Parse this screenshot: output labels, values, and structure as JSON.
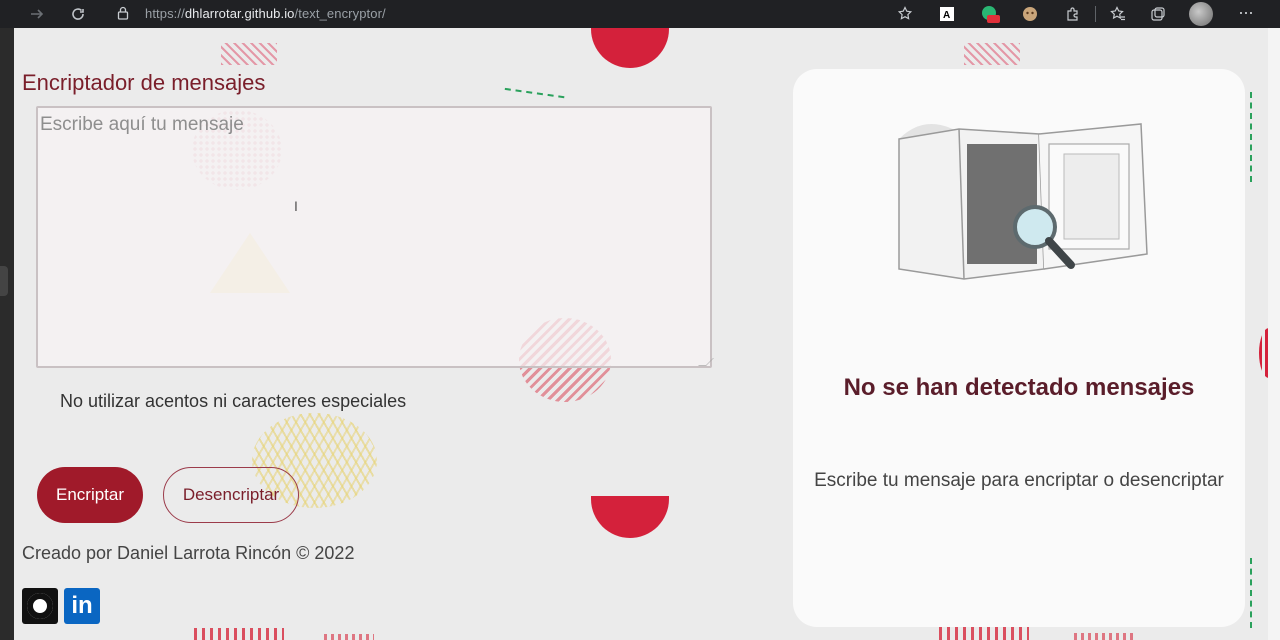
{
  "browser": {
    "url_host": "dhlarrotar.github.io",
    "url_path": "/text_encryptor/",
    "url_scheme": "https://"
  },
  "left": {
    "title": "Encriptador de mensajes",
    "placeholder": "Escribe aquí tu mensaje",
    "hint": "No utilizar acentos ni caracteres especiales",
    "encrypt_label": "Encriptar",
    "decrypt_label": "Desencriptar",
    "footer": "Creado por Daniel Larrota Rincón © 2022",
    "linkedin_label": "in"
  },
  "card": {
    "title": "No se han detectado mensajes",
    "subtitle": "Escribe tu mensaje para encriptar o desencriptar"
  },
  "colors": {
    "accent": "#a01a2a",
    "title": "#7a1e2a",
    "card_title": "#5a1d2a",
    "decor_red": "#d4213b"
  }
}
